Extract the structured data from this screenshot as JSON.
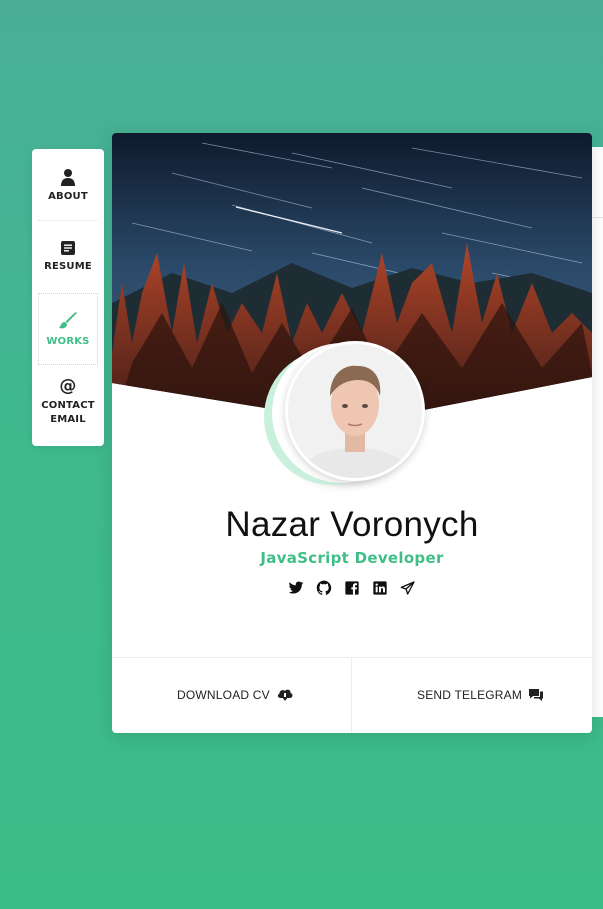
{
  "nav": {
    "items": [
      {
        "label": "ABOUT",
        "icon": "user-icon"
      },
      {
        "label": "RESUME",
        "icon": "document-icon"
      },
      {
        "label": "WORKS",
        "icon": "brush-icon"
      },
      {
        "label": "CONTACT EMAIL",
        "label_line1": "CONTACT",
        "label_line2": "EMAIL",
        "icon": "at-icon"
      }
    ],
    "active": "WORKS"
  },
  "profile": {
    "name": "Nazar Voronych",
    "role": "JavaScript Developer",
    "socials": [
      "twitter-icon",
      "github-icon",
      "facebook-icon",
      "linkedin-icon",
      "telegram-icon"
    ]
  },
  "actions": {
    "download_cv": "DOWNLOAD CV",
    "send_telegram": "SEND TELEGRAM"
  },
  "colors": {
    "accent": "#3fbf87",
    "background_top": "#4aae97",
    "background_bottom": "#3bbd86"
  }
}
